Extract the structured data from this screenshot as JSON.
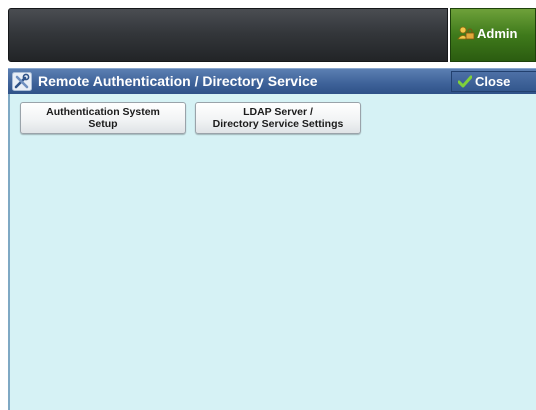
{
  "header": {
    "admin_label": "Admin"
  },
  "titlebar": {
    "title": "Remote Authentication / Directory Service",
    "close_label": "Close"
  },
  "buttons": [
    {
      "line1": "Authentication System",
      "line2": "Setup"
    },
    {
      "line1": "LDAP Server /",
      "line2": "Directory Service Settings"
    }
  ],
  "icons": {
    "admin": "admin-user-icon",
    "title": "tools-icon",
    "close": "checkmark-icon"
  },
  "colors": {
    "panel_bg": "#d6f2f5",
    "titlebar": "#3f639a",
    "admin_green": "#3f7a1b",
    "check_green": "#7fd13b"
  }
}
